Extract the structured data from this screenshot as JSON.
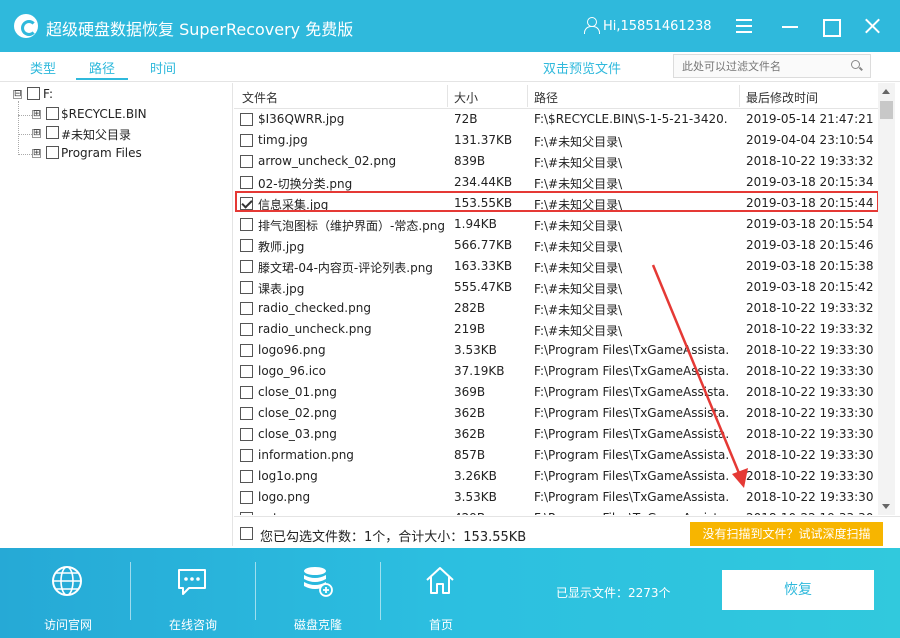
{
  "app": {
    "title": "超级硬盘数据恢复 SuperRecovery 免费版",
    "user": "Hi,15851461238"
  },
  "tabs": [
    {
      "label": "类型",
      "active": false
    },
    {
      "label": "路径",
      "active": true
    },
    {
      "label": "时间",
      "active": false
    }
  ],
  "preview_label": "双击预览文件",
  "filter": {
    "placeholder": "此处可以过滤文件名",
    "value": ""
  },
  "tree": {
    "root": {
      "label": "F:",
      "expander": "⊟"
    },
    "children": [
      {
        "label": "$RECYCLE.BIN",
        "expander": "⊞"
      },
      {
        "label": "#未知父目录",
        "expander": "⊞"
      },
      {
        "label": "Program Files",
        "expander": "⊞"
      }
    ]
  },
  "columns": {
    "name": "文件名",
    "size": "大小",
    "path": "路径",
    "time": "最后修改时间"
  },
  "files": [
    {
      "name": "$I36QWRR.jpg",
      "size": "72B",
      "path": "F:\\$RECYCLE.BIN\\S-1-5-21-3420...",
      "time": "2019-05-14 21:47:21",
      "checked": false
    },
    {
      "name": "timg.jpg",
      "size": "131.37KB",
      "path": "F:\\#未知父目录\\",
      "time": "2019-04-04 23:10:54",
      "checked": false
    },
    {
      "name": "arrow_uncheck_02.png",
      "size": "839B",
      "path": "F:\\#未知父目录\\",
      "time": "2018-10-22 19:33:32",
      "checked": false
    },
    {
      "name": "02-切换分类.png",
      "size": "234.44KB",
      "path": "F:\\#未知父目录\\",
      "time": "2019-03-18 20:15:34",
      "checked": false
    },
    {
      "name": "信息采集.jpg",
      "size": "153.55KB",
      "path": "F:\\#未知父目录\\",
      "time": "2019-03-18 20:15:44",
      "checked": true
    },
    {
      "name": "排气泡图标（维护界面）-常态.png",
      "size": "1.94KB",
      "path": "F:\\#未知父目录\\",
      "time": "2019-03-18 20:15:54",
      "checked": false
    },
    {
      "name": "教师.jpg",
      "size": "566.77KB",
      "path": "F:\\#未知父目录\\",
      "time": "2019-03-18 20:15:46",
      "checked": false
    },
    {
      "name": "滕文珺-04-内容页-评论列表.png",
      "size": "163.33KB",
      "path": "F:\\#未知父目录\\",
      "time": "2019-03-18 20:15:38",
      "checked": false
    },
    {
      "name": "课表.jpg",
      "size": "555.47KB",
      "path": "F:\\#未知父目录\\",
      "time": "2019-03-18 20:15:42",
      "checked": false
    },
    {
      "name": "radio_checked.png",
      "size": "282B",
      "path": "F:\\#未知父目录\\",
      "time": "2018-10-22 19:33:32",
      "checked": false
    },
    {
      "name": "radio_uncheck.png",
      "size": "219B",
      "path": "F:\\#未知父目录\\",
      "time": "2018-10-22 19:33:32",
      "checked": false
    },
    {
      "name": "logo96.png",
      "size": "3.53KB",
      "path": "F:\\Program Files\\TxGameAssista...",
      "time": "2018-10-22 19:33:30",
      "checked": false
    },
    {
      "name": "logo_96.ico",
      "size": "37.19KB",
      "path": "F:\\Program Files\\TxGameAssista...",
      "time": "2018-10-22 19:33:30",
      "checked": false
    },
    {
      "name": "close_01.png",
      "size": "369B",
      "path": "F:\\Program Files\\TxGameAssista...",
      "time": "2018-10-22 19:33:30",
      "checked": false
    },
    {
      "name": "close_02.png",
      "size": "362B",
      "path": "F:\\Program Files\\TxGameAssista...",
      "time": "2018-10-22 19:33:30",
      "checked": false
    },
    {
      "name": "close_03.png",
      "size": "362B",
      "path": "F:\\Program Files\\TxGameAssista...",
      "time": "2018-10-22 19:33:30",
      "checked": false
    },
    {
      "name": "information.png",
      "size": "857B",
      "path": "F:\\Program Files\\TxGameAssista...",
      "time": "2018-10-22 19:33:30",
      "checked": false
    },
    {
      "name": "log1o.png",
      "size": "3.26KB",
      "path": "F:\\Program Files\\TxGameAssista...",
      "time": "2018-10-22 19:33:30",
      "checked": false
    },
    {
      "name": "logo.png",
      "size": "3.53KB",
      "path": "F:\\Program Files\\TxGameAssista...",
      "time": "2018-10-22 19:33:30",
      "checked": false
    },
    {
      "name": "note.png",
      "size": "429B",
      "path": "F:\\Program Files\\TxGameAssista...",
      "time": "2018-10-22 19:33:30",
      "checked": false
    }
  ],
  "selection": {
    "summary": "您已勾选文件数：1个，合计大小：153.55KB"
  },
  "deep_scan_label": "没有扫描到文件？试试深度扫描",
  "bottom_nav": [
    {
      "label": "访问官网",
      "icon": "globe-icon"
    },
    {
      "label": "在线咨询",
      "icon": "chat-icon"
    },
    {
      "label": "磁盘克隆",
      "icon": "database-icon"
    },
    {
      "label": "首页",
      "icon": "home-icon"
    }
  ],
  "shown_count": "已显示文件：2273个",
  "recover_label": "恢复",
  "colors": {
    "accent": "#2fb9dc",
    "warning": "#f7b500",
    "highlight": "#e53935"
  }
}
